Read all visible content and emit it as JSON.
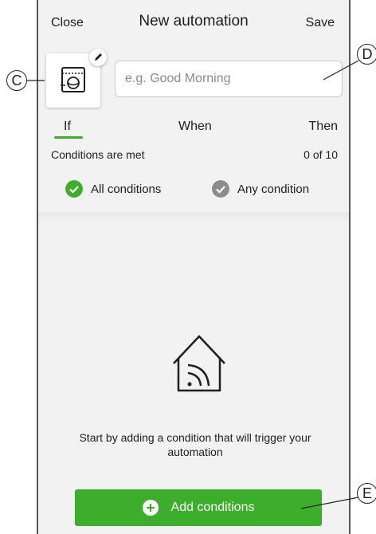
{
  "header": {
    "close_label": "Close",
    "title": "New automation",
    "save_label": "Save"
  },
  "name_field": {
    "placeholder": "e.g. Good Morning",
    "value": ""
  },
  "tabs": [
    {
      "label": "If",
      "active": true
    },
    {
      "label": "When"
    },
    {
      "label": "Then"
    }
  ],
  "conditions": {
    "label": "Conditions are met",
    "count": "0 of 10",
    "options": [
      {
        "label": "All conditions",
        "selected": true,
        "color": "#3dae2b"
      },
      {
        "label": "Any condition",
        "selected": false,
        "color": "#8c8c8c"
      }
    ]
  },
  "empty_state": {
    "icon": "smart-home-icon",
    "message": "Start by adding a condition that will trigger your automation"
  },
  "add_button": {
    "label": "Add conditions",
    "icon": "plus-circle-icon"
  },
  "callouts": {
    "c": "C",
    "d": "D",
    "e": "E"
  },
  "colors": {
    "accent": "#3dae2b",
    "background": "#f2f2f2"
  }
}
